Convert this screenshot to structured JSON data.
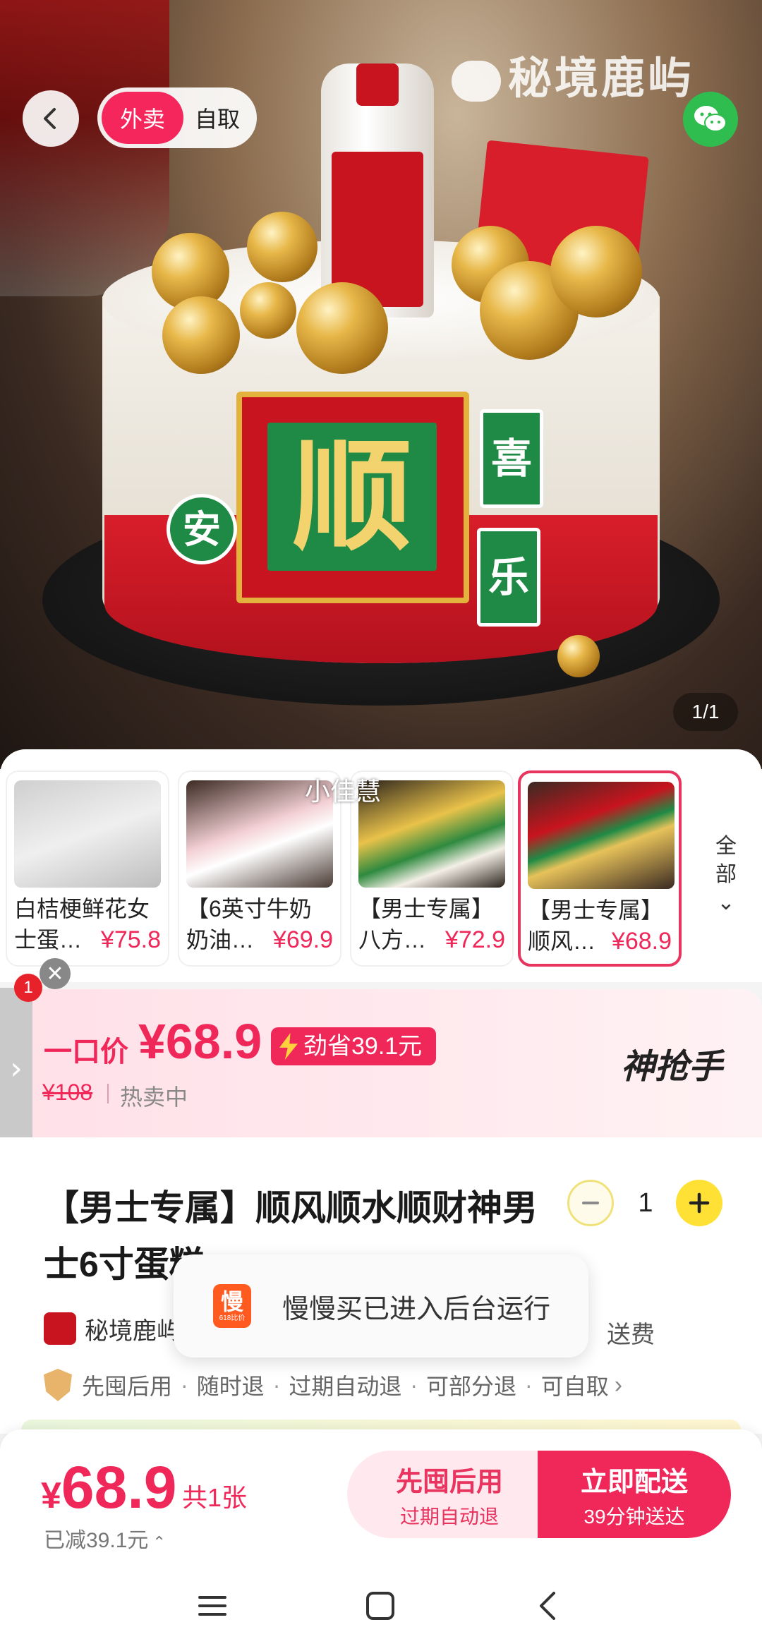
{
  "header": {
    "mode_delivery": "外卖",
    "mode_pickup": "自取",
    "watermark": "秘境鹿屿"
  },
  "hero": {
    "cake_sign_char": "顺",
    "tile_top": "喜",
    "tile_bottom": "乐",
    "tile_left": "安",
    "page_indicator": "1/1"
  },
  "variants": {
    "overlay_text": "小佳慧",
    "items": [
      {
        "line1": "白桔梗鲜花女",
        "line2": "士蛋…",
        "price": "¥75.8",
        "selected": false
      },
      {
        "line1": "【6英寸牛奶",
        "line2": "奶油…",
        "price": "¥69.9",
        "selected": false
      },
      {
        "line1": "【男士专属】",
        "line2": "八方…",
        "price": "¥72.9",
        "selected": false
      },
      {
        "line1": "【男士专属】",
        "line2": "顺风…",
        "price": "¥68.9",
        "selected": true
      }
    ],
    "all_label_1": "全",
    "all_label_2": "部",
    "all_chevron": "⌄"
  },
  "side_panel": {
    "badge": "1",
    "close": "✕",
    "arrow": "›"
  },
  "price_banner": {
    "label": "一口价",
    "price": "¥68.9",
    "saving": "劲省39.1元",
    "original": "¥108",
    "status": "热卖中",
    "brand": "神抢手"
  },
  "product": {
    "title": "【男士专属】顺风顺水顺财神男士6寸蛋糕",
    "quantity": "1",
    "shop_name": "秘境鹿屿",
    "delivery_fee": "送费",
    "guarantees": [
      "先囤后用",
      "随时退",
      "过期自动退",
      "可部分退",
      "可自取"
    ]
  },
  "toast": {
    "icon_glyph": "慢",
    "icon_sub": "618比价",
    "text": "慢慢买已进入后台运行"
  },
  "bottom_bar": {
    "currency": "¥",
    "price": "68.9",
    "count": "共1张",
    "saved": "已减39.1元",
    "saved_arrow": "⌃",
    "btn_left_main": "先囤后用",
    "btn_left_sub": "过期自动退",
    "btn_right_main": "立即配送",
    "btn_right_sub": "39分钟送达"
  },
  "colors": {
    "accent": "#f0285a",
    "qty_plus": "#ffe135",
    "wechat": "#2fbd4f"
  }
}
